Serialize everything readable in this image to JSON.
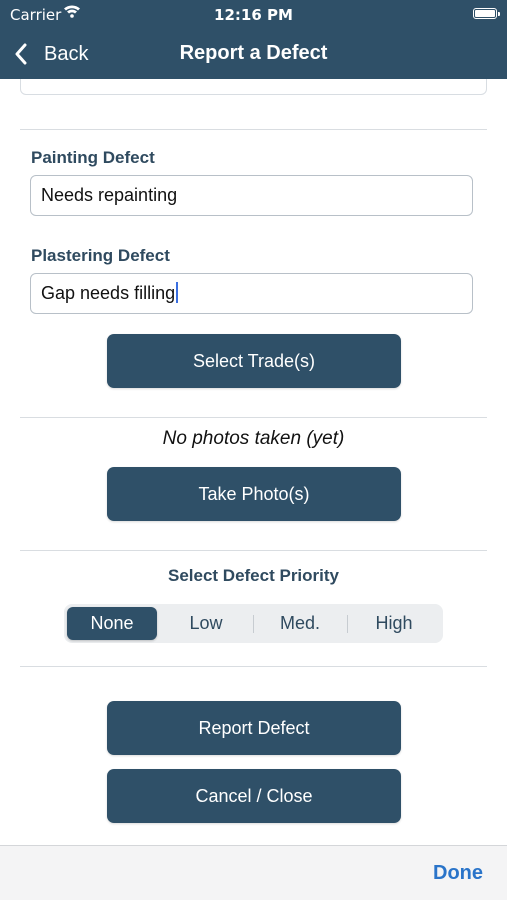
{
  "status_bar": {
    "carrier": "Carrier",
    "time": "12:16 PM"
  },
  "nav": {
    "back_label": "Back",
    "title": "Report a Defect"
  },
  "form": {
    "painting_label": "Painting Defect",
    "painting_value": "Needs repainting",
    "plastering_label": "Plastering Defect",
    "plastering_value": "Gap needs filling",
    "select_trades": "Select Trade(s)",
    "photos_note": "No photos taken (yet)",
    "take_photo": "Take Photo(s)",
    "priority_title": "Select Defect Priority",
    "priority_options": [
      "None",
      "Low",
      "Med.",
      "High"
    ],
    "priority_selected": "None",
    "report": "Report Defect",
    "cancel": "Cancel / Close"
  },
  "toolbar": {
    "done": "Done"
  },
  "colors": {
    "primary": "#2f5068",
    "done": "#2a74c9",
    "caret": "#3b6fe0"
  }
}
